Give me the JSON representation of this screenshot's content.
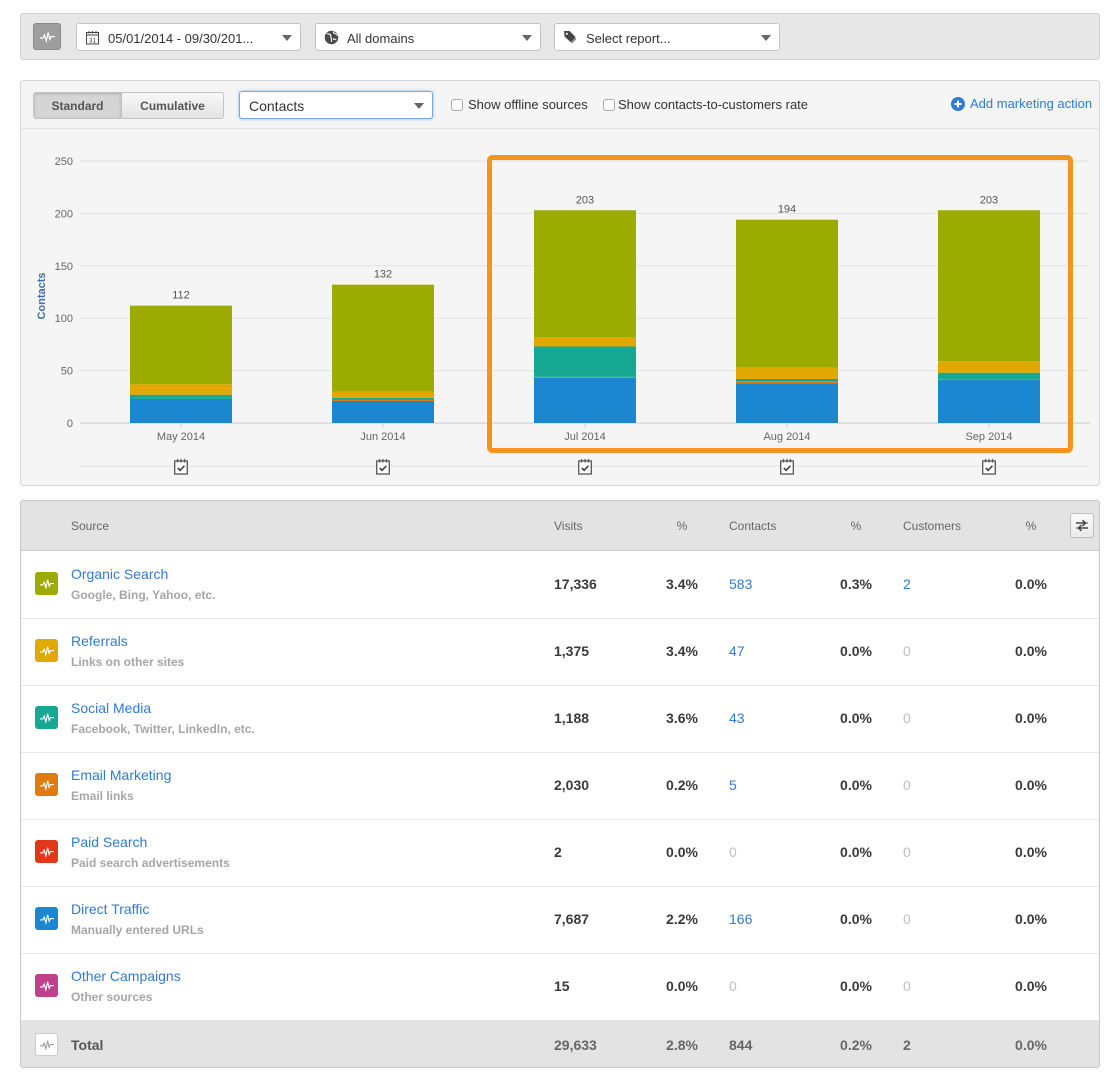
{
  "toolbar": {
    "pulse_icon": "pulse-icon",
    "date_range": {
      "value": "05/01/2014 - 09/30/201...",
      "icon": "calendar-icon"
    },
    "domain": {
      "value": "All domains",
      "icon": "globe-icon"
    },
    "report": {
      "value": "Select report...",
      "icon": "tag-icon"
    }
  },
  "chart_controls": {
    "view_modes": [
      {
        "label": "Standard",
        "active": true
      },
      {
        "label": "Cumulative",
        "active": false
      }
    ],
    "metric_select": "Contacts",
    "show_offline_sources": {
      "label": "Show offline sources",
      "checked": false
    },
    "show_rate": {
      "label": "Show contacts-to-customers rate",
      "checked": false
    },
    "add_action": {
      "label": "Add marketing action",
      "icon": "plus-circle-icon"
    }
  },
  "chart_data": {
    "type": "bar",
    "stacked": true,
    "title": "",
    "xlabel": "",
    "ylabel": "Contacts",
    "ylim": [
      0,
      250
    ],
    "yticks": [
      0,
      50,
      100,
      150,
      200,
      250
    ],
    "grid": true,
    "categories": [
      "May 2014",
      "Jun 2014",
      "Jul 2014",
      "Aug 2014",
      "Sep 2014"
    ],
    "series": [
      {
        "name": "Direct Traffic",
        "color": "#1a87d0",
        "values": [
          23,
          21,
          43,
          38,
          41
        ]
      },
      {
        "name": "Email Marketing",
        "color": "#e07b12",
        "values": [
          0,
          1,
          1,
          2,
          1
        ]
      },
      {
        "name": "Social Media",
        "color": "#17a893",
        "values": [
          4,
          2,
          29,
          2,
          6
        ]
      },
      {
        "name": "Referrals",
        "color": "#e0a800",
        "values": [
          10,
          6,
          9,
          11,
          11
        ]
      },
      {
        "name": "Organic Search",
        "color": "#9bab00",
        "values": [
          75,
          102,
          121,
          141,
          144
        ]
      }
    ],
    "totals": [
      112,
      132,
      203,
      194,
      203
    ],
    "marker_icon": "calendar-check-icon",
    "highlight": {
      "categories": [
        "Jul 2014",
        "Aug 2014",
        "Sep 2014"
      ],
      "color": "#f7941d"
    }
  },
  "table": {
    "columns": {
      "source": "Source",
      "visits": "Visits",
      "visits_pct": "%",
      "contacts": "Contacts",
      "contacts_pct": "%",
      "customers": "Customers",
      "customers_pct": "%"
    },
    "swap_icon": "swap-columns-icon",
    "rows": [
      {
        "name": "Organic Search",
        "description": "Google, Bing, Yahoo, etc.",
        "color": "#9bab00",
        "visits": "17,336",
        "visits_pct": "3.4%",
        "contacts": "583",
        "contacts_pct": "0.3%",
        "customers": "2",
        "customers_pct": "0.0%"
      },
      {
        "name": "Referrals",
        "description": "Links on other sites",
        "color": "#e0a800",
        "visits": "1,375",
        "visits_pct": "3.4%",
        "contacts": "47",
        "contacts_pct": "0.0%",
        "customers": "0",
        "customers_pct": "0.0%"
      },
      {
        "name": "Social Media",
        "description": "Facebook, Twitter, LinkedIn, etc.",
        "color": "#17a893",
        "visits": "1,188",
        "visits_pct": "3.6%",
        "contacts": "43",
        "contacts_pct": "0.0%",
        "customers": "0",
        "customers_pct": "0.0%"
      },
      {
        "name": "Email Marketing",
        "description": "Email links",
        "color": "#e07b12",
        "visits": "2,030",
        "visits_pct": "0.2%",
        "contacts": "5",
        "contacts_pct": "0.0%",
        "customers": "0",
        "customers_pct": "0.0%"
      },
      {
        "name": "Paid Search",
        "description": "Paid search advertisements",
        "color": "#e0391a",
        "visits": "2",
        "visits_pct": "0.0%",
        "contacts": "0",
        "contacts_pct": "0.0%",
        "customers": "0",
        "customers_pct": "0.0%"
      },
      {
        "name": "Direct Traffic",
        "description": "Manually entered URLs",
        "color": "#1a87d0",
        "visits": "7,687",
        "visits_pct": "2.2%",
        "contacts": "166",
        "contacts_pct": "0.0%",
        "customers": "0",
        "customers_pct": "0.0%"
      },
      {
        "name": "Other Campaigns",
        "description": "Other sources",
        "color": "#c0408b",
        "visits": "15",
        "visits_pct": "0.0%",
        "contacts": "0",
        "contacts_pct": "0.0%",
        "customers": "0",
        "customers_pct": "0.0%"
      }
    ],
    "total": {
      "label": "Total",
      "visits": "29,633",
      "visits_pct": "2.8%",
      "contacts": "844",
      "contacts_pct": "0.2%",
      "customers": "2",
      "customers_pct": "0.0%"
    }
  }
}
